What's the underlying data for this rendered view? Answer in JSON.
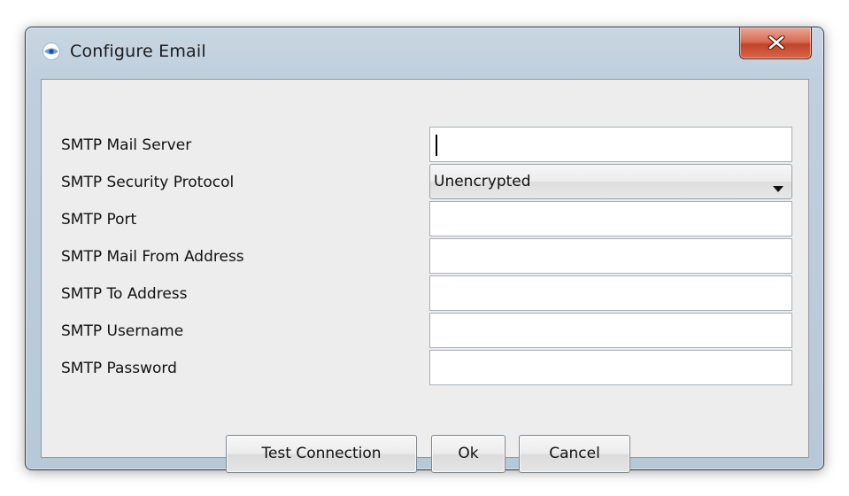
{
  "window": {
    "title": "Configure Email",
    "icon": "eye-logo-icon",
    "close_icon": "close-x-icon",
    "close_color": "#c7452b"
  },
  "form": {
    "fields": [
      {
        "label": "SMTP Mail Server",
        "type": "text",
        "value": "",
        "focused": true
      },
      {
        "label": "SMTP Security Protocol",
        "type": "select",
        "value": "Unencrypted"
      },
      {
        "label": "SMTP Port",
        "type": "text",
        "value": ""
      },
      {
        "label": "SMTP Mail From Address",
        "type": "text",
        "value": ""
      },
      {
        "label": "SMTP To Address",
        "type": "text",
        "value": ""
      },
      {
        "label": "SMTP Username",
        "type": "text",
        "value": ""
      },
      {
        "label": "SMTP Password",
        "type": "password",
        "value": ""
      }
    ]
  },
  "buttons": {
    "test_connection": "Test Connection",
    "ok": "Ok",
    "cancel": "Cancel"
  }
}
